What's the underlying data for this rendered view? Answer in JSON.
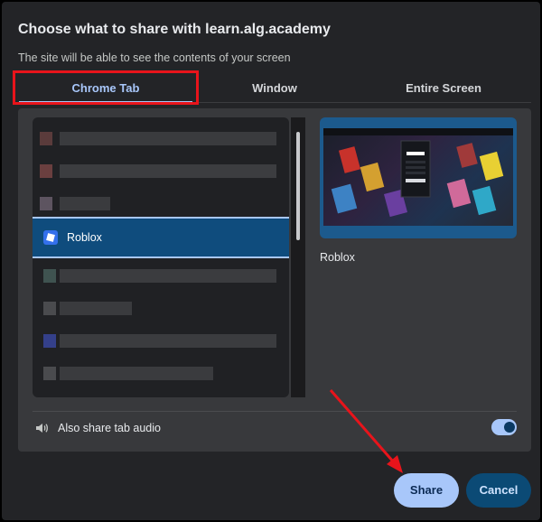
{
  "dialog": {
    "title": "Choose what to share with learn.alg.academy",
    "subtitle": "The site will be able to see the contents of your screen"
  },
  "tabs": [
    {
      "label": "Chrome Tab",
      "active": true
    },
    {
      "label": "Window",
      "active": false
    },
    {
      "label": "Entire Screen",
      "active": false
    }
  ],
  "tab_list": {
    "selected_label": "Roblox",
    "selected_index": 3,
    "item_count": 8
  },
  "preview": {
    "label": "Roblox",
    "icon": "roblox-thumbnail"
  },
  "audio": {
    "label": "Also share tab audio",
    "enabled": true,
    "icon": "speaker-icon"
  },
  "buttons": {
    "share_label": "Share",
    "cancel_label": "Cancel"
  },
  "colors": {
    "accent": "#a8c7fa",
    "selected_bg": "#0f4c7d",
    "highlight_box": "#e8141b",
    "annotation_arrow": "#e8141b"
  }
}
